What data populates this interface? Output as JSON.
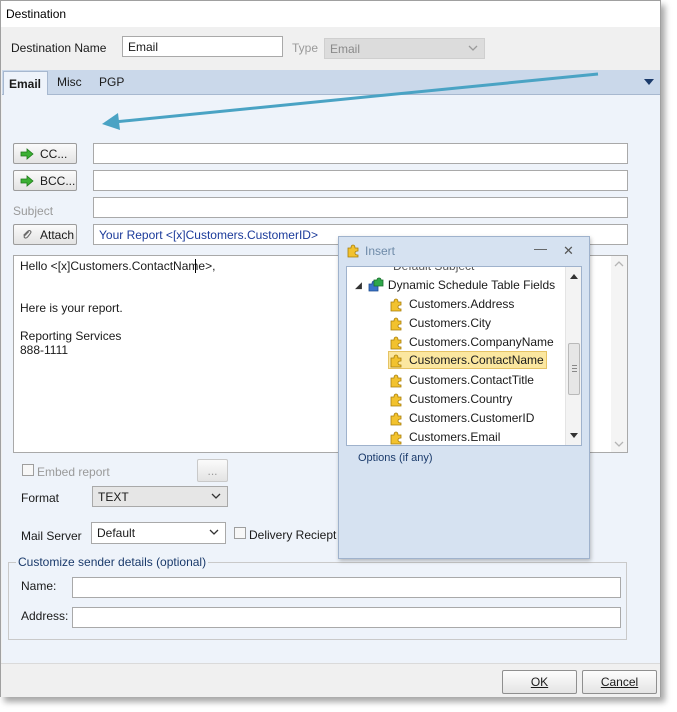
{
  "window": {
    "title": "Destination"
  },
  "header": {
    "destination_name_label": "Destination Name",
    "destination_name_value": "Email",
    "type_label": "Type",
    "type_value": "Email"
  },
  "tabs": [
    {
      "label": "Email",
      "active": true
    },
    {
      "label": "Misc",
      "active": false
    },
    {
      "label": "PGP",
      "active": false
    }
  ],
  "email": {
    "to_value": "",
    "cc_label": "CC...",
    "cc_value": "",
    "bcc_label": "BCC...",
    "bcc_value": "",
    "subject_label": "Subject",
    "subject_value": "",
    "attach_label": "Attach",
    "attach_value": "Your Report <[x]Customers.CustomerID>",
    "body_lines": [
      "Hello <[x]Customers.ContactName>,",
      "",
      "Here is your report.",
      "",
      "Reporting Services",
      "888-1111"
    ],
    "embed_report_label": "Embed report",
    "embed_browse_label": "...",
    "format_label": "Format",
    "format_value": "TEXT",
    "mail_server_label": "Mail Server",
    "mail_server_value": "Default",
    "delivery_receipt_label": "Delivery Reciept"
  },
  "sender": {
    "group_title": "Customize sender details (optional)",
    "name_label": "Name:",
    "name_value": "",
    "address_label": "Address:",
    "address_value": ""
  },
  "footer": {
    "ok_label": "OK",
    "cancel_label": "Cancel"
  },
  "insert_panel": {
    "title": "Insert",
    "partial_item": "Default Subject",
    "parent_node": "Dynamic Schedule Table Fields",
    "items": [
      "Customers.Address",
      "Customers.City",
      "Customers.CompanyName",
      "Customers.ContactName",
      "Customers.ContactTitle",
      "Customers.Country",
      "Customers.CustomerID",
      "Customers.Email"
    ],
    "selected_item": "Customers.ContactName",
    "options_label": "Options (if any)"
  },
  "colors": {
    "arrow": "#4aa3c4",
    "tab_strip": "#cad8ea",
    "panel": "#eef3fa",
    "link_text": "#1a3a6b",
    "selection": "#fbe7a0"
  }
}
